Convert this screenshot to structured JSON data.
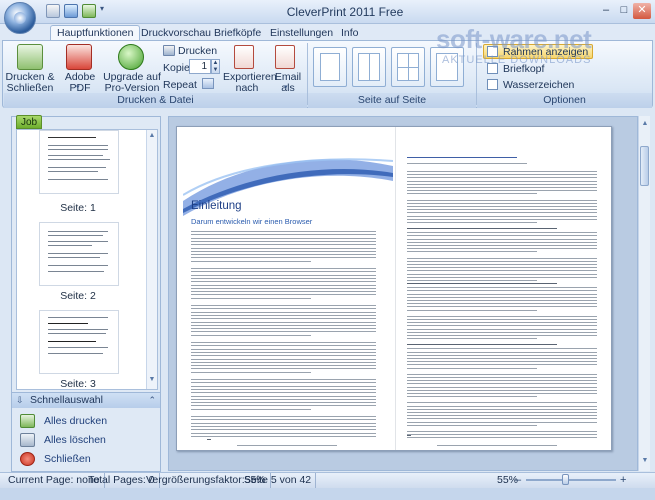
{
  "window": {
    "title": "CleverPrint 2011 Free",
    "controls": [
      "–",
      "□",
      "✕"
    ]
  },
  "tabs": [
    {
      "label": "Hauptfunktionen",
      "active": true
    },
    {
      "label": "Druckvorschau",
      "active": false
    },
    {
      "label": "Briefköpfe",
      "active": false
    },
    {
      "label": "Einstellungen",
      "active": false
    },
    {
      "label": "Info",
      "active": false
    }
  ],
  "ribbon": {
    "print_close": "Drucken &\nSchließen",
    "adobe_pdf": "Adobe PDF",
    "upgrade": "Upgrade auf\nPro-Version",
    "drucken": "Drucken",
    "kopien_label": "Kopien",
    "kopien_value": "1",
    "repeat_label": "Repeat",
    "exportieren": "Exportieren\nnach",
    "email": "Email als",
    "group_print": "Drucken & Datei",
    "group_layout": "Seite auf Seite",
    "group_options": "Optionen",
    "opt_rahmen": "Rahmen anzeigen",
    "opt_briefkopf": "Briefkopf",
    "opt_wasserzeichen": "Wasserzeichen"
  },
  "watermark": {
    "brand": "soft-ware.net",
    "tagline": "AKTUELLE DOWNLOADS"
  },
  "left_panel": {
    "job_tab": "Job",
    "thumbnails": [
      "Seite: 1",
      "Seite: 2",
      "Seite: 3"
    ],
    "quick_header": "Schnellauswahl",
    "quick_items": [
      "Alles drucken",
      "Alles löschen",
      "Schließen"
    ]
  },
  "document": {
    "heading": "Einleitung",
    "subheading": "Darum entwickeln wir einen Browser"
  },
  "status": {
    "current_page": "Current Page: none",
    "total_pages": "Total Pages: 0",
    "zoom_factor": "Vergrößerungsfaktor:55%",
    "page_of": "Seite 5 von 42",
    "zoom": "55%",
    "zoom_minus": "–",
    "zoom_plus": "+"
  },
  "colors": {
    "accent": "#3f5fa6",
    "ribbon_border": "#9fb8d8",
    "job_tab": "#6eae2d"
  },
  "icons": [
    "app-orb-icon",
    "pdf-icon",
    "upgrade-icon",
    "printer-icon",
    "export-icon",
    "email-icon",
    "layout-icon",
    "printer-green-icon",
    "trash-icon",
    "close-red-icon"
  ]
}
